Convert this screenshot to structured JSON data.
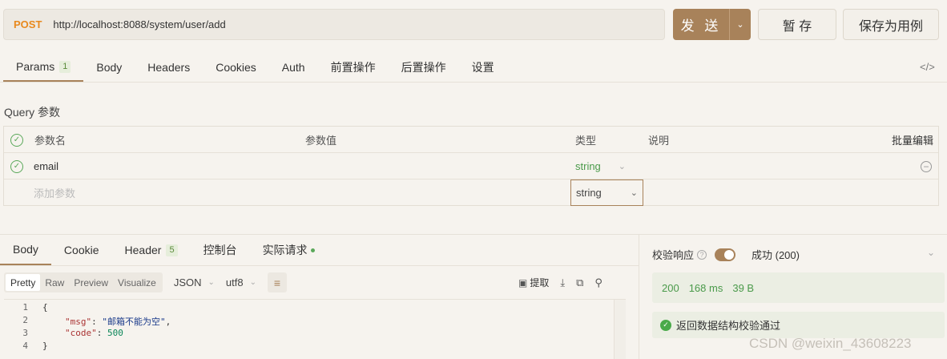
{
  "request": {
    "method": "POST",
    "url": "http://localhost:8088/system/user/add"
  },
  "buttons": {
    "send": "发 送",
    "save_temp": "暂 存",
    "save_as_example": "保存为用例"
  },
  "tabs": [
    {
      "label": "Params",
      "badge": "1"
    },
    {
      "label": "Body"
    },
    {
      "label": "Headers"
    },
    {
      "label": "Cookies"
    },
    {
      "label": "Auth"
    },
    {
      "label": "前置操作"
    },
    {
      "label": "后置操作"
    },
    {
      "label": "设置"
    }
  ],
  "code_toggle": "</>",
  "query": {
    "title": "Query 参数",
    "headers": {
      "name": "参数名",
      "value": "参数值",
      "type": "类型",
      "desc": "说明",
      "bulk": "批量编辑"
    },
    "rows": [
      {
        "name": "email",
        "value": "",
        "type": "string",
        "desc": ""
      }
    ],
    "add_placeholder": "添加参数",
    "add_type": "string"
  },
  "response": {
    "tabs": [
      {
        "label": "Body"
      },
      {
        "label": "Cookie"
      },
      {
        "label": "Header",
        "badge": "5"
      },
      {
        "label": "控制台"
      },
      {
        "label": "实际请求"
      }
    ],
    "formats": [
      "Pretty",
      "Raw",
      "Preview",
      "Visualize"
    ],
    "format_selected": "JSON",
    "encoding": "utf8",
    "extract_label": "提取",
    "code_lines": [
      "1",
      "2",
      "3",
      "4"
    ],
    "body": {
      "msg_key": "\"msg\"",
      "msg_val": "\"邮箱不能为空\"",
      "code_key": "\"code\"",
      "code_val": "500"
    }
  },
  "validation": {
    "label": "校验响应",
    "enabled": true,
    "result": "成功 (200)",
    "status_code": "200",
    "time": "168 ms",
    "size": "39 B",
    "pass_text": "返回数据结构校验通过"
  },
  "watermark": "CSDN @weixin_43608223"
}
